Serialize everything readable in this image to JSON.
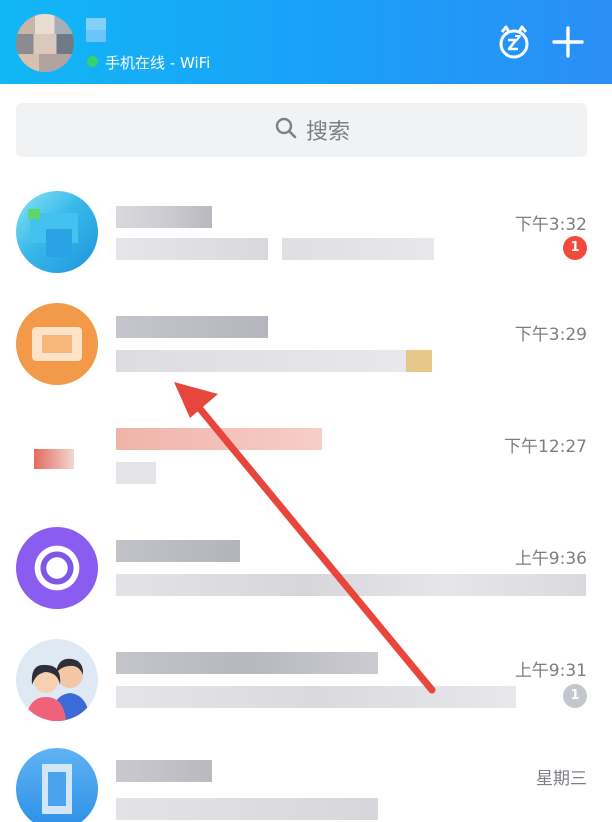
{
  "header": {
    "status": "手机在线 - WiFi",
    "icons": [
      "alarm-cat-icon",
      "plus-icon"
    ]
  },
  "search": {
    "placeholder": "搜索"
  },
  "conversations": [
    {
      "time": "下午3:32",
      "unread": "1",
      "badge_color": "#f24b3b"
    },
    {
      "time": "下午3:29"
    },
    {
      "time": "下午12:27"
    },
    {
      "time": "上午9:36"
    },
    {
      "time": "上午9:31",
      "unread": "1",
      "badge_color": "#c3c6cc"
    },
    {
      "time": "星期三"
    }
  ],
  "colors": {
    "header_gradient_start": "#12b7f5",
    "header_gradient_end": "#2b8ff6",
    "arrow": "#e8453c"
  }
}
